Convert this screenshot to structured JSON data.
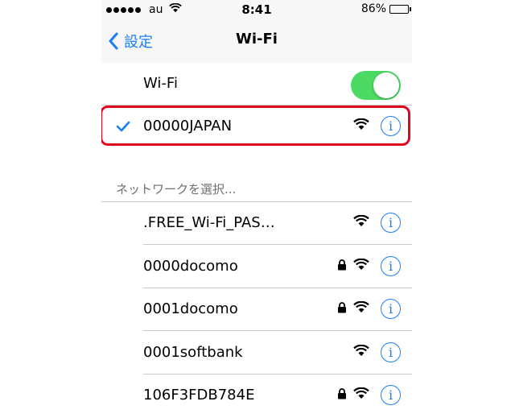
{
  "status_bar": {
    "carrier": "au",
    "time": "8:41",
    "battery_percent": "86%",
    "battery_level": 0.86,
    "signal_icon": "signal-dots-icon",
    "wifi_icon": "wifi-icon"
  },
  "nav": {
    "back_label": "設定",
    "title": "Wi-Fi"
  },
  "wifi_toggle": {
    "label": "Wi-Fi",
    "on": true,
    "color": "#4cd964"
  },
  "connected": {
    "name": "00000JAPAN",
    "locked": false
  },
  "section_header": "ネットワークを選択...",
  "networks": [
    {
      "name": ".FREE_Wi-Fi_PAS…",
      "locked": false
    },
    {
      "name": "0000docomo",
      "locked": true
    },
    {
      "name": "0001docomo",
      "locked": true
    },
    {
      "name": "0001softbank",
      "locked": false
    },
    {
      "name": "106F3FDB784E",
      "locked": true
    }
  ],
  "colors": {
    "accent": "#1a7ef7",
    "highlight": "#e1071b"
  },
  "info_glyph": "i"
}
